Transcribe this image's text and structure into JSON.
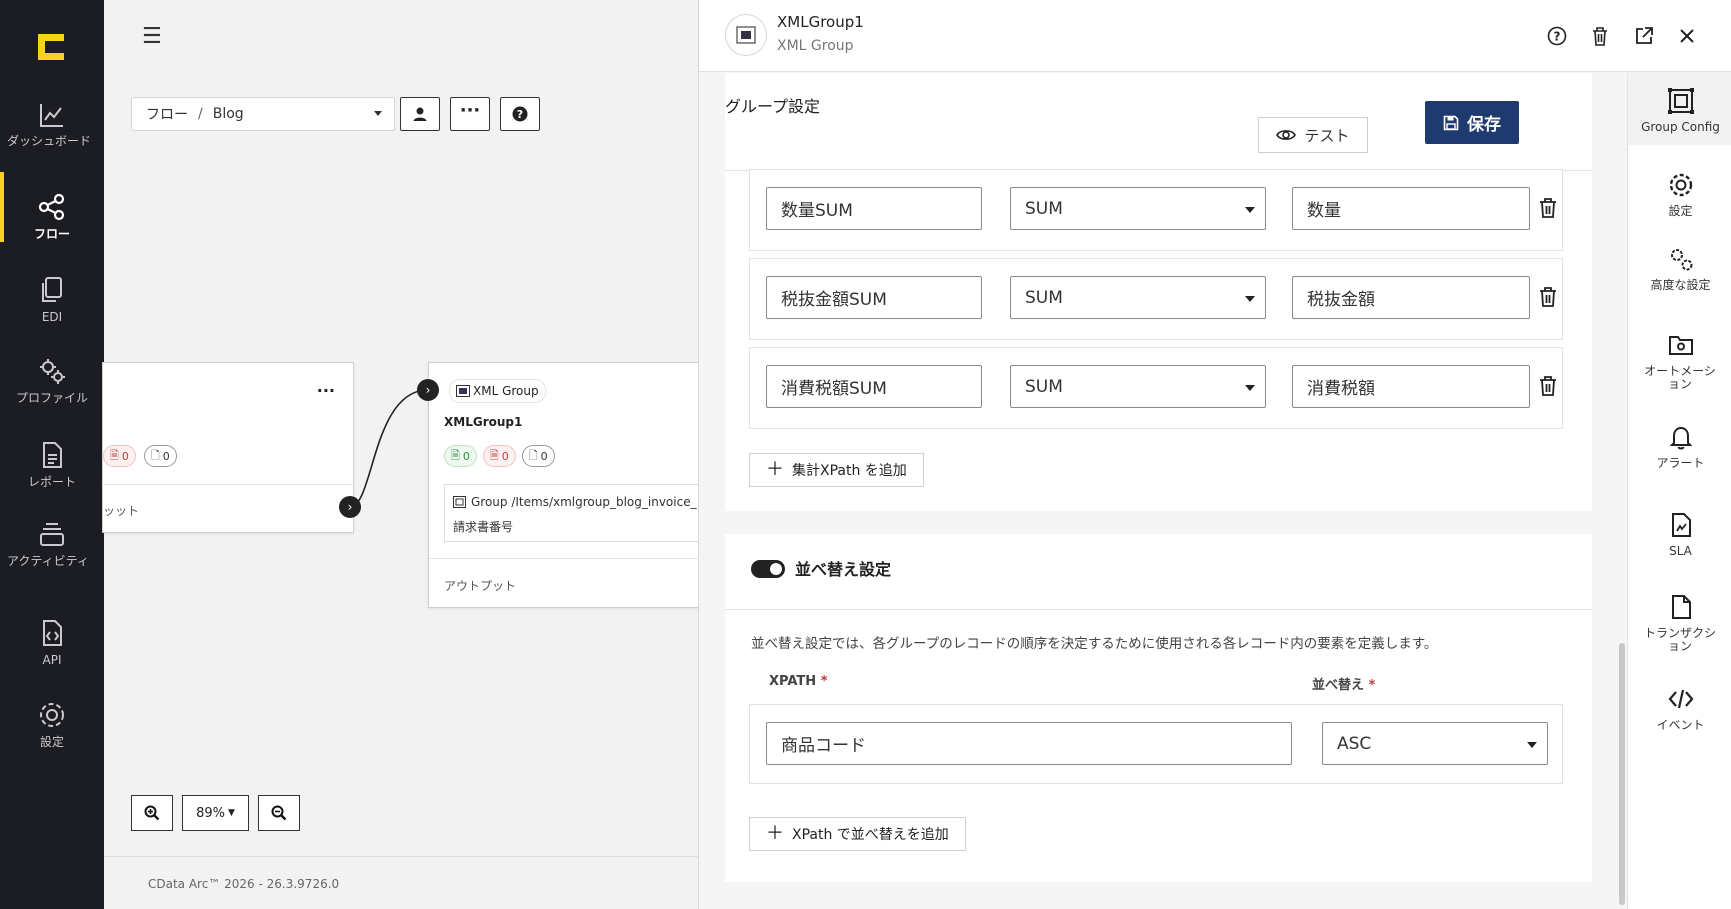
{
  "nav": {
    "items": [
      {
        "label": "ダッシュボード",
        "icon": "chart-line-icon"
      },
      {
        "label": "フロー",
        "icon": "share-nodes-icon"
      },
      {
        "label": "EDI",
        "icon": "documents-icon"
      },
      {
        "label": "プロファイル",
        "icon": "gears-icon"
      },
      {
        "label": "レポート",
        "icon": "report-icon"
      },
      {
        "label": "アクティビティ",
        "icon": "stack-icon"
      },
      {
        "label": "API",
        "icon": "api-file-icon"
      },
      {
        "label": "設定",
        "icon": "gear-icon"
      }
    ],
    "active": "フロー",
    "accent": "#f7d21e"
  },
  "canvas": {
    "breadcrumb": {
      "root": "フロー",
      "sep": "/",
      "current": "Blog"
    },
    "left_node": {
      "counts": {
        "error": "0",
        "file": "0"
      },
      "output_label": "ッット"
    },
    "xml_node": {
      "type": "XML Group",
      "name": "XMLGroup1",
      "counts": {
        "success": "0",
        "error": "0",
        "file": "0"
      },
      "xpath": "Group /Items/xmlgroup_blog_invoice_",
      "xpath_sub": "請求書番号",
      "output_label": "アウトプット"
    },
    "zoom": "89%",
    "footer": "CData Arc™ 2026 - 26.3.9726.0"
  },
  "panel": {
    "title": "XMLGroup1",
    "subtitle": "XML Group",
    "section_title": "グループ設定",
    "test_label": "テスト",
    "save_label": "保存",
    "aggregates": [
      {
        "name": "数量SUM",
        "func": "SUM",
        "field": "数量"
      },
      {
        "name": "税抜金額SUM",
        "func": "SUM",
        "field": "税抜金額"
      },
      {
        "name": "消費税額SUM",
        "func": "SUM",
        "field": "消費税額"
      }
    ],
    "add_aggregate_label": "集計XPath を追加",
    "sort": {
      "title": "並べ替え設定",
      "enabled": true,
      "description": "並べ替え設定では、各グループのレコードの順序を決定するために使用される各レコード内の要素を定義します。",
      "xpath_header": "XPATH",
      "order_header": "並べ替え",
      "required_mark": "*",
      "xpath_value": "商品コード",
      "order_value": "ASC",
      "add_label": "XPath で並べ替えを追加"
    }
  },
  "rail": {
    "items": [
      {
        "label": "Group Config",
        "icon": "group-config-icon"
      },
      {
        "label": "設定",
        "icon": "gear-icon"
      },
      {
        "label": "高度な設定",
        "icon": "gears-icon"
      },
      {
        "label": "オートメーション",
        "icon": "automation-icon"
      },
      {
        "label": "アラート",
        "icon": "bell-icon"
      },
      {
        "label": "SLA",
        "icon": "sla-icon"
      },
      {
        "label": "トランザクション",
        "icon": "transaction-icon"
      },
      {
        "label": "イベント",
        "icon": "code-icon"
      }
    ]
  },
  "colors": {
    "save_bg": "#1e3a6e",
    "nav_bg": "#1c1d22",
    "required": "#c43b3b"
  }
}
